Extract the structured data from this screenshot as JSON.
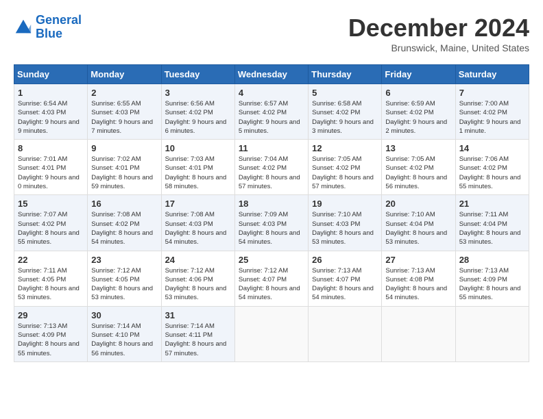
{
  "header": {
    "logo_line1": "General",
    "logo_line2": "Blue",
    "month": "December 2024",
    "location": "Brunswick, Maine, United States"
  },
  "days_of_week": [
    "Sunday",
    "Monday",
    "Tuesday",
    "Wednesday",
    "Thursday",
    "Friday",
    "Saturday"
  ],
  "weeks": [
    [
      {
        "day": "1",
        "data": "Sunrise: 6:54 AM\nSunset: 4:03 PM\nDaylight: 9 hours and 9 minutes."
      },
      {
        "day": "2",
        "data": "Sunrise: 6:55 AM\nSunset: 4:03 PM\nDaylight: 9 hours and 7 minutes."
      },
      {
        "day": "3",
        "data": "Sunrise: 6:56 AM\nSunset: 4:02 PM\nDaylight: 9 hours and 6 minutes."
      },
      {
        "day": "4",
        "data": "Sunrise: 6:57 AM\nSunset: 4:02 PM\nDaylight: 9 hours and 5 minutes."
      },
      {
        "day": "5",
        "data": "Sunrise: 6:58 AM\nSunset: 4:02 PM\nDaylight: 9 hours and 3 minutes."
      },
      {
        "day": "6",
        "data": "Sunrise: 6:59 AM\nSunset: 4:02 PM\nDaylight: 9 hours and 2 minutes."
      },
      {
        "day": "7",
        "data": "Sunrise: 7:00 AM\nSunset: 4:02 PM\nDaylight: 9 hours and 1 minute."
      }
    ],
    [
      {
        "day": "8",
        "data": "Sunrise: 7:01 AM\nSunset: 4:01 PM\nDaylight: 9 hours and 0 minutes."
      },
      {
        "day": "9",
        "data": "Sunrise: 7:02 AM\nSunset: 4:01 PM\nDaylight: 8 hours and 59 minutes."
      },
      {
        "day": "10",
        "data": "Sunrise: 7:03 AM\nSunset: 4:01 PM\nDaylight: 8 hours and 58 minutes."
      },
      {
        "day": "11",
        "data": "Sunrise: 7:04 AM\nSunset: 4:02 PM\nDaylight: 8 hours and 57 minutes."
      },
      {
        "day": "12",
        "data": "Sunrise: 7:05 AM\nSunset: 4:02 PM\nDaylight: 8 hours and 57 minutes."
      },
      {
        "day": "13",
        "data": "Sunrise: 7:05 AM\nSunset: 4:02 PM\nDaylight: 8 hours and 56 minutes."
      },
      {
        "day": "14",
        "data": "Sunrise: 7:06 AM\nSunset: 4:02 PM\nDaylight: 8 hours and 55 minutes."
      }
    ],
    [
      {
        "day": "15",
        "data": "Sunrise: 7:07 AM\nSunset: 4:02 PM\nDaylight: 8 hours and 55 minutes."
      },
      {
        "day": "16",
        "data": "Sunrise: 7:08 AM\nSunset: 4:02 PM\nDaylight: 8 hours and 54 minutes."
      },
      {
        "day": "17",
        "data": "Sunrise: 7:08 AM\nSunset: 4:03 PM\nDaylight: 8 hours and 54 minutes."
      },
      {
        "day": "18",
        "data": "Sunrise: 7:09 AM\nSunset: 4:03 PM\nDaylight: 8 hours and 54 minutes."
      },
      {
        "day": "19",
        "data": "Sunrise: 7:10 AM\nSunset: 4:03 PM\nDaylight: 8 hours and 53 minutes."
      },
      {
        "day": "20",
        "data": "Sunrise: 7:10 AM\nSunset: 4:04 PM\nDaylight: 8 hours and 53 minutes."
      },
      {
        "day": "21",
        "data": "Sunrise: 7:11 AM\nSunset: 4:04 PM\nDaylight: 8 hours and 53 minutes."
      }
    ],
    [
      {
        "day": "22",
        "data": "Sunrise: 7:11 AM\nSunset: 4:05 PM\nDaylight: 8 hours and 53 minutes."
      },
      {
        "day": "23",
        "data": "Sunrise: 7:12 AM\nSunset: 4:05 PM\nDaylight: 8 hours and 53 minutes."
      },
      {
        "day": "24",
        "data": "Sunrise: 7:12 AM\nSunset: 4:06 PM\nDaylight: 8 hours and 53 minutes."
      },
      {
        "day": "25",
        "data": "Sunrise: 7:12 AM\nSunset: 4:07 PM\nDaylight: 8 hours and 54 minutes."
      },
      {
        "day": "26",
        "data": "Sunrise: 7:13 AM\nSunset: 4:07 PM\nDaylight: 8 hours and 54 minutes."
      },
      {
        "day": "27",
        "data": "Sunrise: 7:13 AM\nSunset: 4:08 PM\nDaylight: 8 hours and 54 minutes."
      },
      {
        "day": "28",
        "data": "Sunrise: 7:13 AM\nSunset: 4:09 PM\nDaylight: 8 hours and 55 minutes."
      }
    ],
    [
      {
        "day": "29",
        "data": "Sunrise: 7:13 AM\nSunset: 4:09 PM\nDaylight: 8 hours and 55 minutes."
      },
      {
        "day": "30",
        "data": "Sunrise: 7:14 AM\nSunset: 4:10 PM\nDaylight: 8 hours and 56 minutes."
      },
      {
        "day": "31",
        "data": "Sunrise: 7:14 AM\nSunset: 4:11 PM\nDaylight: 8 hours and 57 minutes."
      },
      {
        "day": "",
        "data": ""
      },
      {
        "day": "",
        "data": ""
      },
      {
        "day": "",
        "data": ""
      },
      {
        "day": "",
        "data": ""
      }
    ]
  ]
}
